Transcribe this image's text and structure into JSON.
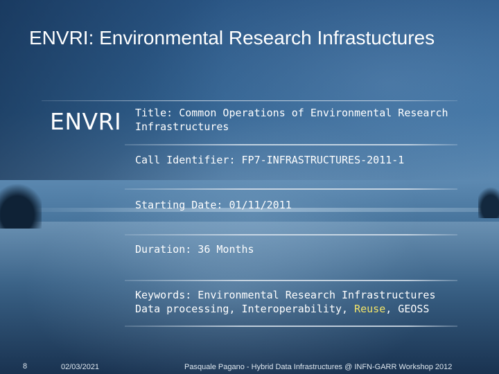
{
  "slide": {
    "title": "ENVRI: Environmental Research Infrastuctures",
    "logo_text": "ENVRI"
  },
  "fields": {
    "title_line": "Title: Common Operations of Environmental Research Infrastructures",
    "call_identifier": "Call Identifier: FP7-INFRASTRUCTURES-2011-1",
    "starting_date": "Starting Date: 01/11/2011",
    "duration": "Duration: 36 Months",
    "keywords_line1": "Keywords: Environmental Research Infrastructures",
    "keywords_line2_before": "Data processing, Interoperability, ",
    "keywords_highlight": "Reuse",
    "keywords_line2_after": ", GEOSS"
  },
  "footer": {
    "page_number": "8",
    "date": "02/03/2021",
    "credit": "Pasquale Pagano - Hybrid Data Infrastructures @ INFN-GARR Workshop 2012"
  },
  "colors": {
    "highlight": "#f2e46a",
    "text": "#ffffff"
  }
}
